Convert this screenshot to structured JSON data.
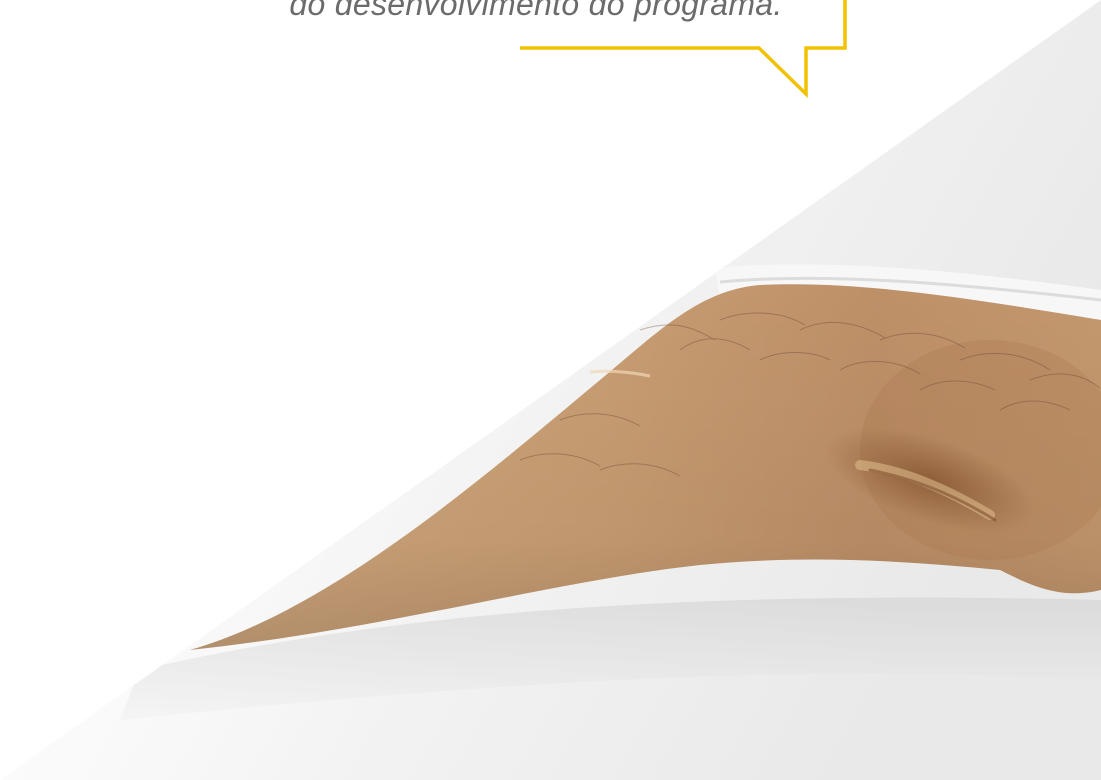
{
  "quote": {
    "text": "do desenvolvimento do programa."
  },
  "colors": {
    "accent": "#f2c100",
    "text": "#6b6b6b",
    "background": "#ffffff"
  },
  "image": {
    "subject": "forearm-with-scar"
  }
}
